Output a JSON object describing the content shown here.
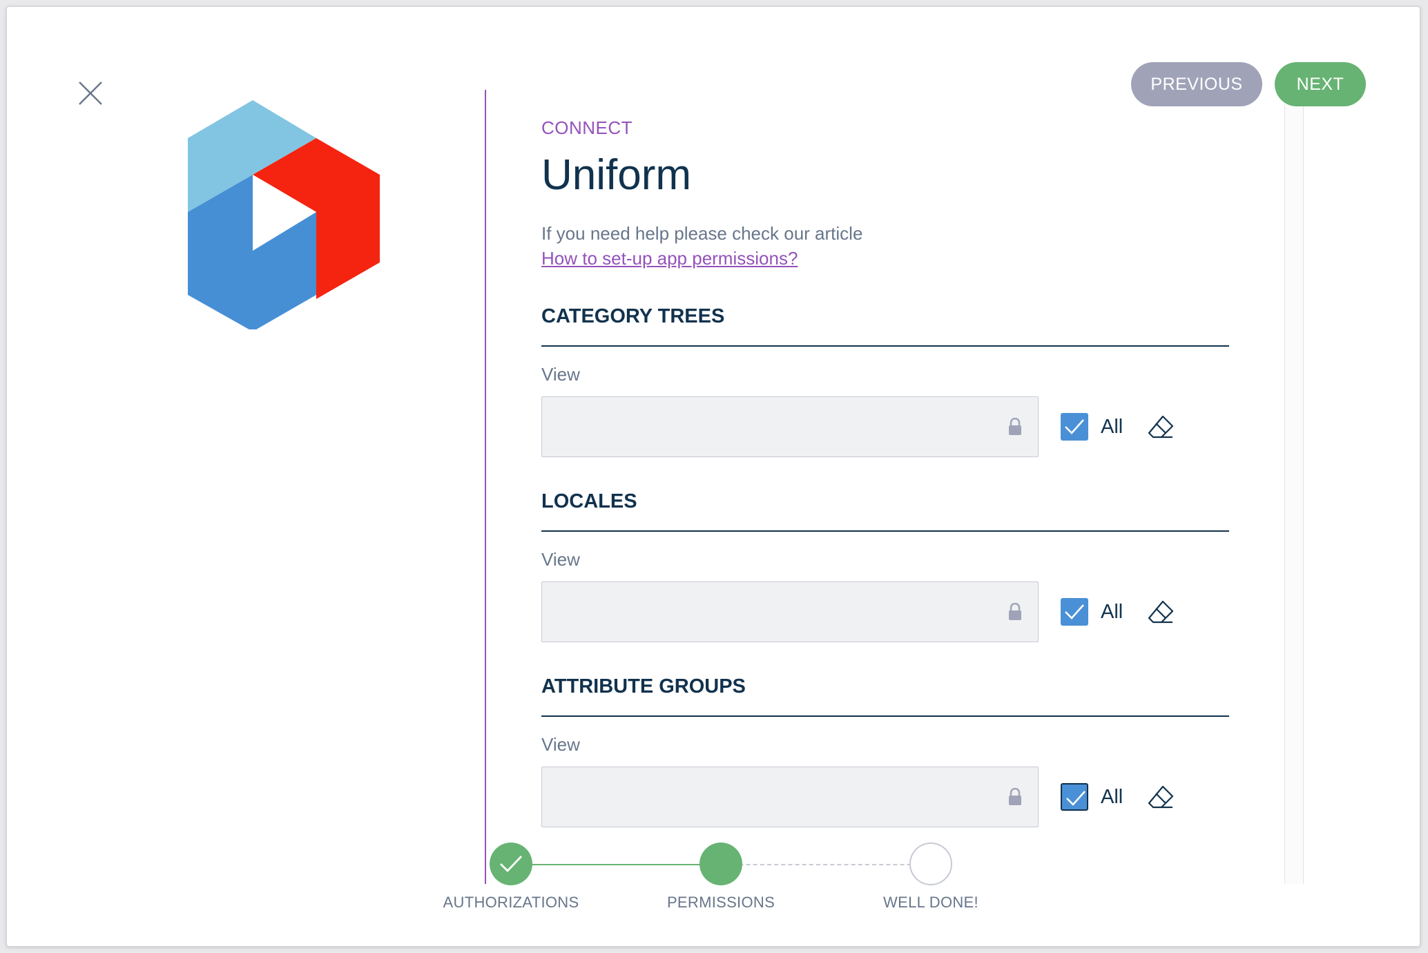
{
  "header": {
    "previous_label": "PREVIOUS",
    "next_label": "NEXT"
  },
  "app": {
    "eyebrow": "CONNECT",
    "name": "Uniform",
    "help_text": "If you need help please check our article",
    "help_link": "How to set-up app permissions?"
  },
  "sections": [
    {
      "title": "CATEGORY TREES",
      "view_label": "View",
      "all_label": "All",
      "all_checked": true
    },
    {
      "title": "LOCALES",
      "view_label": "View",
      "all_label": "All",
      "all_checked": true
    },
    {
      "title": "ATTRIBUTE GROUPS",
      "view_label": "View",
      "all_label": "All",
      "all_checked": true
    }
  ],
  "stepper": {
    "steps": [
      {
        "label": "AUTHORIZATIONS",
        "state": "done"
      },
      {
        "label": "PERMISSIONS",
        "state": "current"
      },
      {
        "label": "WELL DONE!",
        "state": "todo"
      }
    ]
  },
  "colors": {
    "accent_purple": "#9452ba",
    "primary_green": "#67b373",
    "secondary_grey": "#a0a3b8",
    "text_dark": "#11324d",
    "checkbox_blue": "#4a90d6",
    "logo_light_blue": "#82c5e2",
    "logo_blue": "#468fd5",
    "logo_red": "#f42410"
  },
  "icons": {
    "close": "close-icon",
    "lock": "lock-icon",
    "check": "check-icon",
    "eraser": "eraser-icon"
  }
}
